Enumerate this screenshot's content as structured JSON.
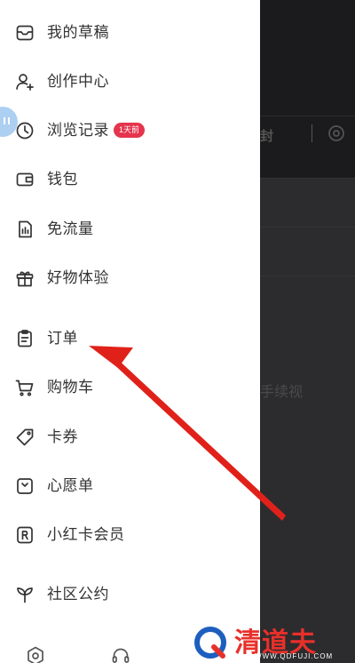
{
  "drawer": {
    "items": [
      {
        "id": "drafts",
        "label": "我的草稿",
        "icon": "drafts-icon"
      },
      {
        "id": "creator",
        "label": "创作中心",
        "icon": "user-add-icon"
      },
      {
        "id": "history",
        "label": "浏览记录",
        "icon": "clock-icon",
        "badge": "1天前"
      },
      {
        "id": "wallet",
        "label": "钱包",
        "icon": "wallet-icon"
      },
      {
        "id": "data",
        "label": "免流量",
        "icon": "data-icon"
      },
      {
        "id": "goods",
        "label": "好物体验",
        "icon": "gift-icon"
      },
      {
        "id": "orders",
        "label": "订单",
        "icon": "clipboard-icon"
      },
      {
        "id": "cart",
        "label": "购物车",
        "icon": "cart-icon"
      },
      {
        "id": "coupons",
        "label": "卡券",
        "icon": "tag-icon"
      },
      {
        "id": "wishlist",
        "label": "心愿单",
        "icon": "wish-icon"
      },
      {
        "id": "membership",
        "label": "小红卡会员",
        "icon": "r-badge-icon"
      },
      {
        "id": "community",
        "label": "社区公约",
        "icon": "sprout-icon"
      }
    ],
    "bottom_icons": [
      "settings-icon",
      "headset-icon"
    ]
  },
  "background_page": {
    "strip_text": "封",
    "mid_text": "手续视"
  },
  "watermark": {
    "text": "清道夫",
    "url": "WWW.QDFUJI.COM",
    "color": "#e8302b"
  },
  "colors": {
    "badge": "#e5344d",
    "arrow": "#e0211a",
    "overlay": "#2c2c2e"
  }
}
